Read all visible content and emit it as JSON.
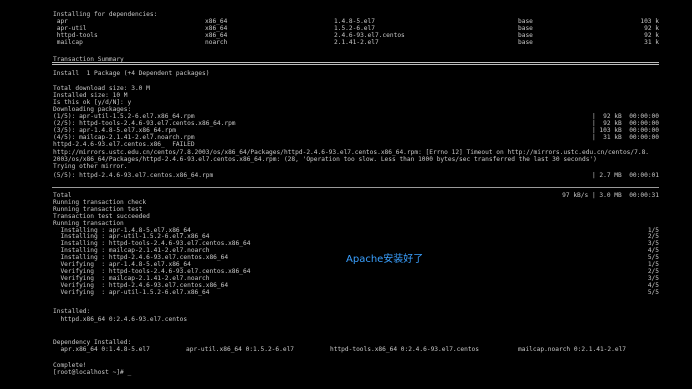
{
  "lines": [
    [
      "Installing for dependencies:"
    ],
    [
      " apr",
      "x86_64",
      "1.4.8-5.el7",
      "base",
      "103 k"
    ],
    [
      " apr-util",
      "x86_64",
      "1.5.2-6.el7",
      "base",
      "92 k"
    ],
    [
      " httpd-tools",
      "x86_64",
      "2.4.6-93.el7.centos",
      "base",
      "92 k"
    ],
    [
      " mailcap",
      "noarch",
      "2.1.41-2.el7",
      "base",
      "31 k"
    ],
    [
      ""
    ],
    [
      "Transaction Summary"
    ],
    [
      ""
    ],
    [
      "Install  1 Package (+4 Dependent packages)"
    ],
    [
      ""
    ],
    [
      "Total download size: 3.0 M"
    ],
    [
      "Installed size: 10 M"
    ],
    [
      "Is this ok [y/d/N]: y"
    ],
    [
      "Downloading packages:"
    ],
    [
      "(1/5): apr-util-1.5.2-6.el7.x86_64.rpm",
      "|  92 kB  00:00:00"
    ],
    [
      "(2/5): httpd-tools-2.4.6-93.el7.centos.x86_64.rpm",
      "|  92 kB  00:00:00"
    ],
    [
      "(3/5): apr-1.4.8-5.el7.x86_64.rpm",
      "| 103 kB  00:00:00"
    ],
    [
      "(4/5): mailcap-2.1.41-2.el7.noarch.rpm",
      "|  31 kB  00:00:00"
    ],
    [
      "httpd-2.4.6-93.el7.centos.x86_  FAILED"
    ],
    [
      "http://mirrors.ustc.edu.cn/centos/7.8.2003/os/x86_64/Packages/httpd-2.4.6-93.el7.centos.x86_64.rpm: [Errno 12] Timeout on http://mirrors.ustc.edu.cn/centos/7.8."
    ],
    [
      "2003/os/x86_64/Packages/httpd-2.4.6-93.el7.centos.x86_64.rpm: (28, 'Operation too slow. Less than 1000 bytes/sec transferred the last 30 seconds')"
    ],
    [
      "Trying other mirror."
    ],
    [
      "(5/5): httpd-2.4.6-93.el7.centos.x86_64.rpm",
      "| 2.7 MB  00:00:01"
    ],
    [
      ""
    ],
    [
      "Total",
      "97 kB/s | 3.0 MB  00:00:31"
    ],
    [
      "Running transaction check"
    ],
    [
      "Running transaction test"
    ],
    [
      "Transaction test succeeded"
    ],
    [
      "Running transaction"
    ],
    [
      "  Installing : apr-1.4.8-5.el7.x86_64",
      "1/5"
    ],
    [
      "  Installing : apr-util-1.5.2-6.el7.x86_64",
      "2/5"
    ],
    [
      "  Installing : httpd-tools-2.4.6-93.el7.centos.x86_64",
      "3/5"
    ],
    [
      "  Installing : mailcap-2.1.41-2.el7.noarch",
      "4/5"
    ],
    [
      "  Installing : httpd-2.4.6-93.el7.centos.x86_64",
      "5/5"
    ],
    [
      "  Verifying  : apr-1.4.8-5.el7.x86_64",
      "1/5"
    ],
    [
      "  Verifying  : httpd-tools-2.4.6-93.el7.centos.x86_64",
      "2/5"
    ],
    [
      "  Verifying  : mailcap-2.1.41-2.el7.noarch",
      "3/5"
    ],
    [
      "  Verifying  : httpd-2.4.6-93.el7.centos.x86_64",
      "4/5"
    ],
    [
      "  Verifying  : apr-util-1.5.2-6.el7.x86_64",
      "5/5"
    ],
    [
      ""
    ],
    [
      "Installed:"
    ],
    [
      "  httpd.x86_64 0:2.4.6-93.el7.centos"
    ],
    [
      ""
    ],
    [
      "Dependency Installed:"
    ],
    [
      "  apr.x86_64 0:1.4.8-5.el7",
      "apr-util.x86_64 0:1.5.2-6.el7",
      "httpd-tools.x86_64 0:2.4.6-93.el7.centos",
      "mailcap.noarch 0:2.1.41-2.el7"
    ],
    [
      ""
    ],
    [
      "Complete!"
    ],
    [
      "[root@localhost ~]# _"
    ]
  ],
  "overlay_text": "Apache安装好了"
}
